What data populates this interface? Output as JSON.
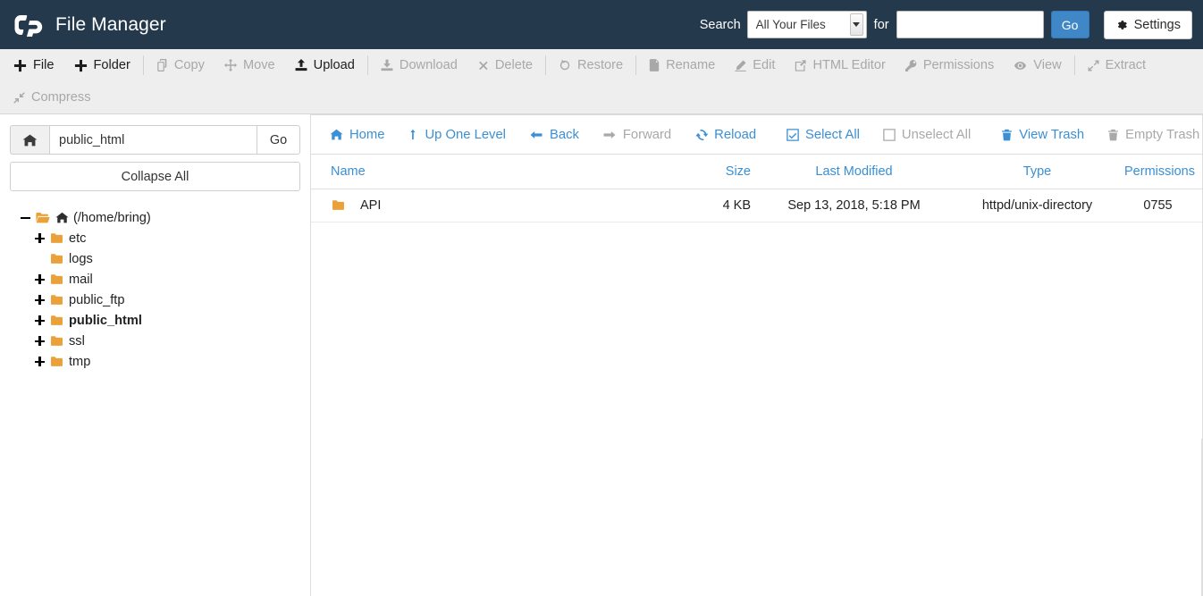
{
  "header": {
    "brand_title": "File Manager",
    "logo_alt": "cP",
    "search_label": "Search",
    "search_scope_value": "All Your Files",
    "for_label": "for",
    "search_value": "",
    "search_placeholder": "",
    "go_label": "Go",
    "settings_label": "Settings",
    "accent_color": "#3f87c7",
    "background_color": "#25394d"
  },
  "toolbar": {
    "row1": [
      {
        "label": "File",
        "icon": "plus-icon",
        "enabled": true
      },
      {
        "label": "Folder",
        "icon": "plus-icon",
        "enabled": true
      },
      {
        "label": "Copy",
        "icon": "copy-icon",
        "enabled": false
      },
      {
        "label": "Move",
        "icon": "move-icon",
        "enabled": false
      },
      {
        "label": "Upload",
        "icon": "upload-icon",
        "enabled": true
      },
      {
        "label": "Download",
        "icon": "download-icon",
        "enabled": false
      },
      {
        "label": "Delete",
        "icon": "delete-x-icon",
        "enabled": false
      },
      {
        "label": "Restore",
        "icon": "restore-icon",
        "enabled": false
      },
      {
        "label": "Rename",
        "icon": "file-icon",
        "enabled": false
      },
      {
        "label": "Edit",
        "icon": "pencil-icon",
        "enabled": false
      },
      {
        "label": "HTML Editor",
        "icon": "html-editor-icon",
        "enabled": false
      },
      {
        "label": "Permissions",
        "icon": "key-icon",
        "enabled": false
      },
      {
        "label": "View",
        "icon": "eye-icon",
        "enabled": false
      },
      {
        "label": "Extract",
        "icon": "extract-icon",
        "enabled": false
      }
    ],
    "row2": [
      {
        "label": "Compress",
        "icon": "compress-icon",
        "enabled": false
      }
    ]
  },
  "sidebar": {
    "home_icon": "home-icon",
    "path_value": "public_html",
    "go_label": "Go",
    "collapse_all_label": "Collapse All",
    "tree": [
      {
        "label": "(/home/bring)",
        "level": 0,
        "expander": "minus",
        "icon": "open-folder-home-icon",
        "selected": false
      },
      {
        "label": "etc",
        "level": 1,
        "expander": "plus",
        "icon": "folder-icon",
        "selected": false
      },
      {
        "label": "logs",
        "level": 1,
        "expander": "none",
        "icon": "folder-icon",
        "selected": false
      },
      {
        "label": "mail",
        "level": 1,
        "expander": "plus",
        "icon": "folder-icon",
        "selected": false
      },
      {
        "label": "public_ftp",
        "level": 1,
        "expander": "plus",
        "icon": "folder-icon",
        "selected": false
      },
      {
        "label": "public_html",
        "level": 1,
        "expander": "plus",
        "icon": "folder-icon",
        "selected": true
      },
      {
        "label": "ssl",
        "level": 1,
        "expander": "plus",
        "icon": "folder-icon",
        "selected": false
      },
      {
        "label": "tmp",
        "level": 1,
        "expander": "plus",
        "icon": "folder-icon",
        "selected": false
      }
    ]
  },
  "navbar": [
    {
      "label": "Home",
      "icon": "home-icon",
      "enabled": true
    },
    {
      "label": "Up One Level",
      "icon": "arrow-up-icon",
      "enabled": true
    },
    {
      "label": "Back",
      "icon": "arrow-left-icon",
      "enabled": true
    },
    {
      "label": "Forward",
      "icon": "arrow-right-icon",
      "enabled": false
    },
    {
      "label": "Reload",
      "icon": "reload-icon",
      "enabled": true
    },
    {
      "label": "Select All",
      "icon": "checkbox-checked-icon",
      "enabled": true
    },
    {
      "label": "Unselect All",
      "icon": "checkbox-empty-icon",
      "enabled": false
    },
    {
      "label": "View Trash",
      "icon": "trash-icon",
      "enabled": true
    },
    {
      "label": "Empty Trash",
      "icon": "trash-icon",
      "enabled": false
    }
  ],
  "file_table": {
    "columns": [
      "Name",
      "Size",
      "Last Modified",
      "Type",
      "Permissions"
    ],
    "rows": [
      {
        "icon": "folder-icon",
        "name": "API",
        "size": "4 KB",
        "last_modified": "Sep 13, 2018, 5:18 PM",
        "type": "httpd/unix-directory",
        "permissions": "0755"
      }
    ]
  }
}
